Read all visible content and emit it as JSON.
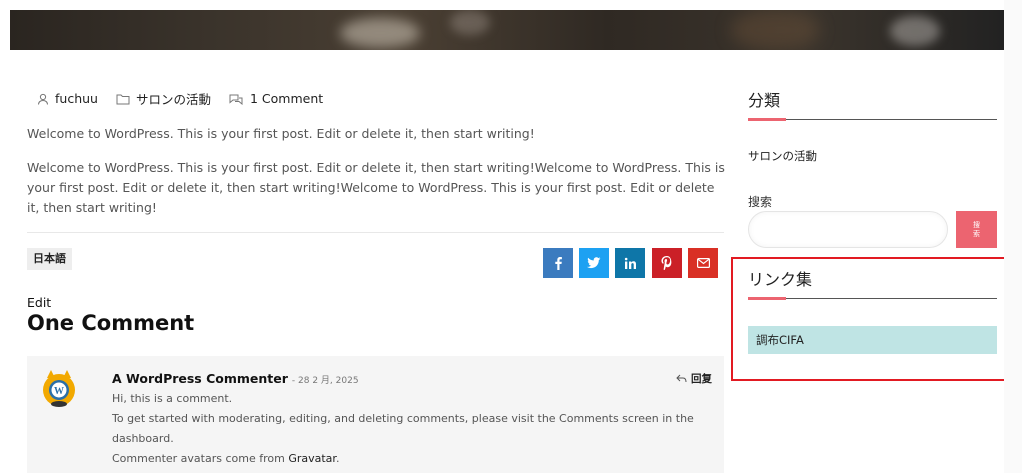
{
  "post": {
    "author": "fuchuu",
    "category": "サロンの活動",
    "comments_count": "1 Comment",
    "paragraph1": "Welcome to WordPress. This is your first post. Edit or delete it, then start writing!",
    "paragraph2": "Welcome to WordPress. This is your first post. Edit or delete it, then start writing!Welcome to WordPress. This is your first post. Edit or delete it, then start writing!Welcome to WordPress. This is your first post. Edit or delete it, then start writing!",
    "language_tag": "日本語",
    "edit_label": "Edit",
    "comments_heading": "One Comment"
  },
  "share": {
    "buttons": [
      {
        "icon": "facebook-icon",
        "color": "#3b7bbf"
      },
      {
        "icon": "twitter-icon",
        "color": "#1da1f2"
      },
      {
        "icon": "linkedin-icon",
        "color": "#0e76a8"
      },
      {
        "icon": "pinterest-icon",
        "color": "#cb2027"
      },
      {
        "icon": "email-icon",
        "color": "#d93025"
      }
    ]
  },
  "comment": {
    "author": "A WordPress Commenter",
    "date": "- 28 2 月, 2025",
    "reply_label": "回复",
    "line1": "Hi, this is a comment.",
    "line2": "To get started with moderating, editing, and deleting comments, please visit the Comments screen in the dashboard.",
    "line3_prefix": "Commenter avatars come from ",
    "line3_link": "Gravatar",
    "line3_suffix": "."
  },
  "sidebar": {
    "categories_title": "分類",
    "category_item": "サロンの活動",
    "search_label": "搜索",
    "search_button": "搜索",
    "search_placeholder": "",
    "links_title": "リンク集",
    "link_item": "調布CIFA"
  },
  "colors": {
    "accent": "#ec6470",
    "highlight_border": "#e21a22",
    "link_bg": "#bfe4e4"
  }
}
